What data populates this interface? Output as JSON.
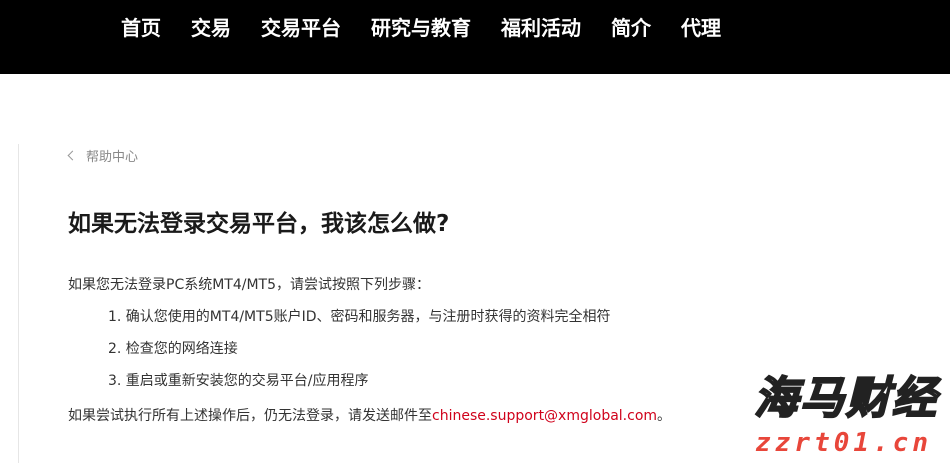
{
  "nav": {
    "items": [
      {
        "label": "首页"
      },
      {
        "label": "交易"
      },
      {
        "label": "交易平台"
      },
      {
        "label": "研究与教育"
      },
      {
        "label": "福利活动"
      },
      {
        "label": "简介"
      },
      {
        "label": "代理"
      }
    ]
  },
  "breadcrumb": {
    "label": "帮助中心"
  },
  "article": {
    "title": "如果无法登录交易平台，我该怎么做?",
    "intro": "如果您无法登录PC系统MT4/MT5，请尝试按照下列步骤：",
    "steps": [
      "1. 确认您使用的MT4/MT5账户ID、密码和服务器，与注册时获得的资料完全相符",
      "2. 检查您的网络连接",
      "3. 重启或重新安装您的交易平台/应用程序"
    ],
    "outro_prefix": "如果尝试执行所有上述操作后，仍无法登录，请发送邮件至",
    "email": "chinese.support@xmglobal.com",
    "outro_suffix": "。"
  },
  "watermark": {
    "logo_text": "海马财经",
    "url_text": "zzrt01.cn"
  },
  "colors": {
    "topbar": "#000000",
    "link": "#d0021b",
    "watermark_url": "#e8463a"
  }
}
